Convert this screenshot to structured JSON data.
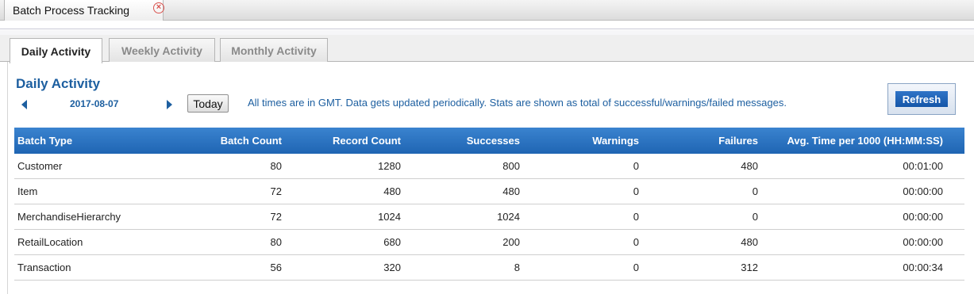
{
  "window": {
    "tab_title": "Batch Process Tracking"
  },
  "tabs": [
    {
      "label": "Daily Activity",
      "active": true
    },
    {
      "label": "Weekly Activity",
      "active": false
    },
    {
      "label": "Monthly Activity",
      "active": false
    }
  ],
  "section": {
    "title": "Daily Activity",
    "date": "2017-08-07",
    "today_label": "Today",
    "info": "All times are in GMT. Data gets updated periodically. Stats are shown as total of successful/warnings/failed messages.",
    "refresh_label": "Refresh"
  },
  "table": {
    "headers": [
      "Batch Type",
      "Batch Count",
      "Record Count",
      "Successes",
      "Warnings",
      "Failures",
      "Avg. Time per 1000 (HH:MM:SS)"
    ],
    "rows": [
      [
        "Customer",
        "80",
        "1280",
        "800",
        "0",
        "480",
        "00:01:00"
      ],
      [
        "Item",
        "72",
        "480",
        "480",
        "0",
        "0",
        "00:00:00"
      ],
      [
        "MerchandiseHierarchy",
        "72",
        "1024",
        "1024",
        "0",
        "0",
        "00:00:00"
      ],
      [
        "RetailLocation",
        "80",
        "680",
        "200",
        "0",
        "480",
        "00:00:00"
      ],
      [
        "Transaction",
        "56",
        "320",
        "8",
        "0",
        "312",
        "00:00:34"
      ]
    ]
  },
  "colors": {
    "accent": "#1d5fa0",
    "header_bg": "#2a72c0",
    "close": "#d9534f"
  }
}
